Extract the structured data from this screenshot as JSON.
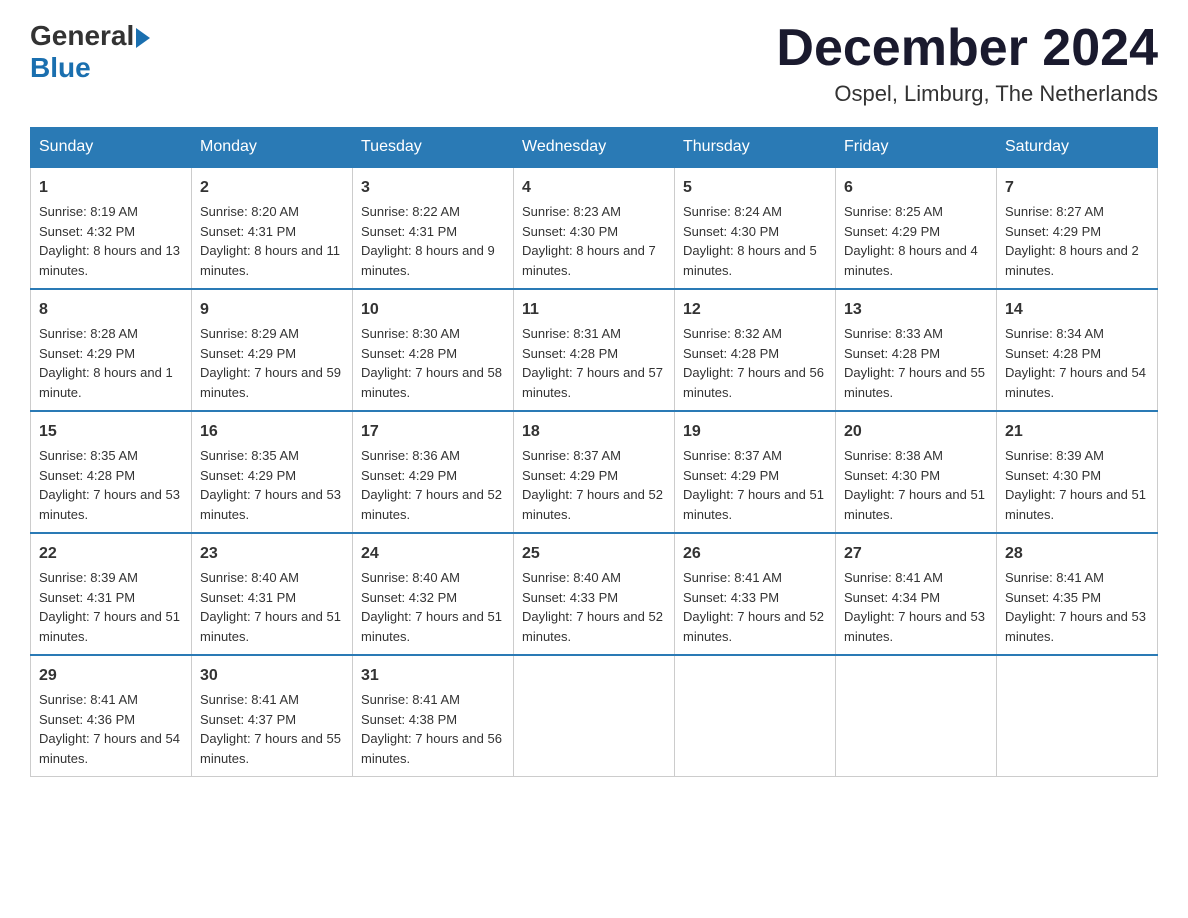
{
  "header": {
    "logo": {
      "general": "General",
      "blue": "Blue"
    },
    "title": "December 2024",
    "location": "Ospel, Limburg, The Netherlands"
  },
  "days_of_week": [
    "Sunday",
    "Monday",
    "Tuesday",
    "Wednesday",
    "Thursday",
    "Friday",
    "Saturday"
  ],
  "weeks": [
    [
      {
        "day": "1",
        "sunrise": "Sunrise: 8:19 AM",
        "sunset": "Sunset: 4:32 PM",
        "daylight": "Daylight: 8 hours and 13 minutes."
      },
      {
        "day": "2",
        "sunrise": "Sunrise: 8:20 AM",
        "sunset": "Sunset: 4:31 PM",
        "daylight": "Daylight: 8 hours and 11 minutes."
      },
      {
        "day": "3",
        "sunrise": "Sunrise: 8:22 AM",
        "sunset": "Sunset: 4:31 PM",
        "daylight": "Daylight: 8 hours and 9 minutes."
      },
      {
        "day": "4",
        "sunrise": "Sunrise: 8:23 AM",
        "sunset": "Sunset: 4:30 PM",
        "daylight": "Daylight: 8 hours and 7 minutes."
      },
      {
        "day": "5",
        "sunrise": "Sunrise: 8:24 AM",
        "sunset": "Sunset: 4:30 PM",
        "daylight": "Daylight: 8 hours and 5 minutes."
      },
      {
        "day": "6",
        "sunrise": "Sunrise: 8:25 AM",
        "sunset": "Sunset: 4:29 PM",
        "daylight": "Daylight: 8 hours and 4 minutes."
      },
      {
        "day": "7",
        "sunrise": "Sunrise: 8:27 AM",
        "sunset": "Sunset: 4:29 PM",
        "daylight": "Daylight: 8 hours and 2 minutes."
      }
    ],
    [
      {
        "day": "8",
        "sunrise": "Sunrise: 8:28 AM",
        "sunset": "Sunset: 4:29 PM",
        "daylight": "Daylight: 8 hours and 1 minute."
      },
      {
        "day": "9",
        "sunrise": "Sunrise: 8:29 AM",
        "sunset": "Sunset: 4:29 PM",
        "daylight": "Daylight: 7 hours and 59 minutes."
      },
      {
        "day": "10",
        "sunrise": "Sunrise: 8:30 AM",
        "sunset": "Sunset: 4:28 PM",
        "daylight": "Daylight: 7 hours and 58 minutes."
      },
      {
        "day": "11",
        "sunrise": "Sunrise: 8:31 AM",
        "sunset": "Sunset: 4:28 PM",
        "daylight": "Daylight: 7 hours and 57 minutes."
      },
      {
        "day": "12",
        "sunrise": "Sunrise: 8:32 AM",
        "sunset": "Sunset: 4:28 PM",
        "daylight": "Daylight: 7 hours and 56 minutes."
      },
      {
        "day": "13",
        "sunrise": "Sunrise: 8:33 AM",
        "sunset": "Sunset: 4:28 PM",
        "daylight": "Daylight: 7 hours and 55 minutes."
      },
      {
        "day": "14",
        "sunrise": "Sunrise: 8:34 AM",
        "sunset": "Sunset: 4:28 PM",
        "daylight": "Daylight: 7 hours and 54 minutes."
      }
    ],
    [
      {
        "day": "15",
        "sunrise": "Sunrise: 8:35 AM",
        "sunset": "Sunset: 4:28 PM",
        "daylight": "Daylight: 7 hours and 53 minutes."
      },
      {
        "day": "16",
        "sunrise": "Sunrise: 8:35 AM",
        "sunset": "Sunset: 4:29 PM",
        "daylight": "Daylight: 7 hours and 53 minutes."
      },
      {
        "day": "17",
        "sunrise": "Sunrise: 8:36 AM",
        "sunset": "Sunset: 4:29 PM",
        "daylight": "Daylight: 7 hours and 52 minutes."
      },
      {
        "day": "18",
        "sunrise": "Sunrise: 8:37 AM",
        "sunset": "Sunset: 4:29 PM",
        "daylight": "Daylight: 7 hours and 52 minutes."
      },
      {
        "day": "19",
        "sunrise": "Sunrise: 8:37 AM",
        "sunset": "Sunset: 4:29 PM",
        "daylight": "Daylight: 7 hours and 51 minutes."
      },
      {
        "day": "20",
        "sunrise": "Sunrise: 8:38 AM",
        "sunset": "Sunset: 4:30 PM",
        "daylight": "Daylight: 7 hours and 51 minutes."
      },
      {
        "day": "21",
        "sunrise": "Sunrise: 8:39 AM",
        "sunset": "Sunset: 4:30 PM",
        "daylight": "Daylight: 7 hours and 51 minutes."
      }
    ],
    [
      {
        "day": "22",
        "sunrise": "Sunrise: 8:39 AM",
        "sunset": "Sunset: 4:31 PM",
        "daylight": "Daylight: 7 hours and 51 minutes."
      },
      {
        "day": "23",
        "sunrise": "Sunrise: 8:40 AM",
        "sunset": "Sunset: 4:31 PM",
        "daylight": "Daylight: 7 hours and 51 minutes."
      },
      {
        "day": "24",
        "sunrise": "Sunrise: 8:40 AM",
        "sunset": "Sunset: 4:32 PM",
        "daylight": "Daylight: 7 hours and 51 minutes."
      },
      {
        "day": "25",
        "sunrise": "Sunrise: 8:40 AM",
        "sunset": "Sunset: 4:33 PM",
        "daylight": "Daylight: 7 hours and 52 minutes."
      },
      {
        "day": "26",
        "sunrise": "Sunrise: 8:41 AM",
        "sunset": "Sunset: 4:33 PM",
        "daylight": "Daylight: 7 hours and 52 minutes."
      },
      {
        "day": "27",
        "sunrise": "Sunrise: 8:41 AM",
        "sunset": "Sunset: 4:34 PM",
        "daylight": "Daylight: 7 hours and 53 minutes."
      },
      {
        "day": "28",
        "sunrise": "Sunrise: 8:41 AM",
        "sunset": "Sunset: 4:35 PM",
        "daylight": "Daylight: 7 hours and 53 minutes."
      }
    ],
    [
      {
        "day": "29",
        "sunrise": "Sunrise: 8:41 AM",
        "sunset": "Sunset: 4:36 PM",
        "daylight": "Daylight: 7 hours and 54 minutes."
      },
      {
        "day": "30",
        "sunrise": "Sunrise: 8:41 AM",
        "sunset": "Sunset: 4:37 PM",
        "daylight": "Daylight: 7 hours and 55 minutes."
      },
      {
        "day": "31",
        "sunrise": "Sunrise: 8:41 AM",
        "sunset": "Sunset: 4:38 PM",
        "daylight": "Daylight: 7 hours and 56 minutes."
      },
      null,
      null,
      null,
      null
    ]
  ]
}
